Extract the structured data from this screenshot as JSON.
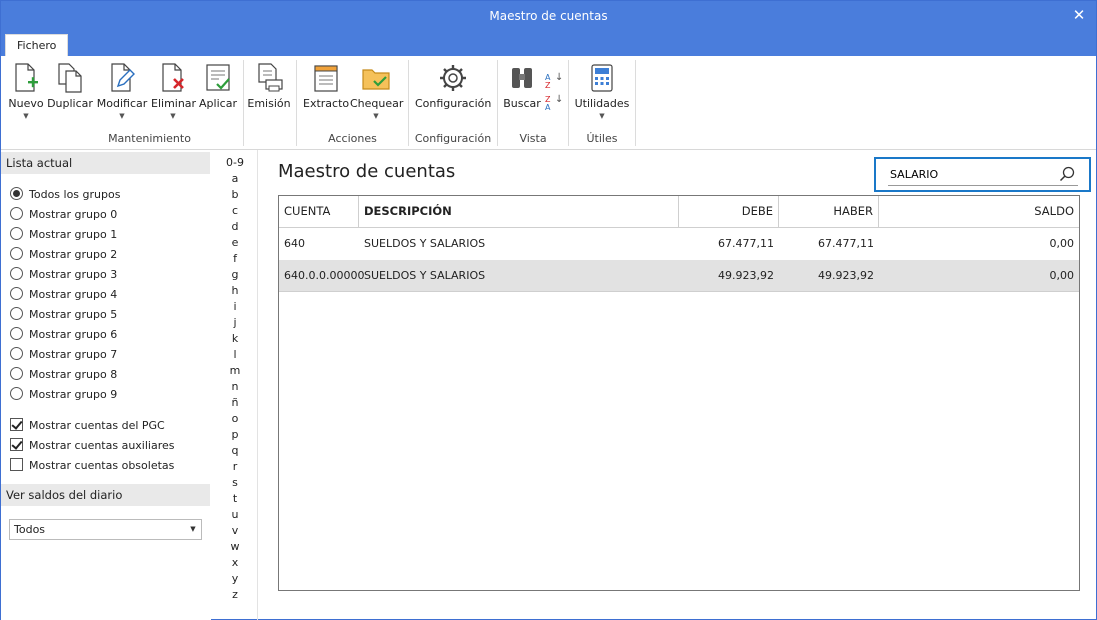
{
  "window": {
    "title": "Maestro de cuentas",
    "close_glyph": "✕"
  },
  "tabs": {
    "fichero": "Fichero"
  },
  "ribbon": {
    "buttons": {
      "nuevo": "Nuevo",
      "duplicar": "Duplicar",
      "modificar": "Modificar",
      "eliminar": "Eliminar",
      "aplicar": "Aplicar",
      "emision": "Emisión",
      "extracto": "Extracto",
      "chequear": "Chequear",
      "configuracion": "Configuración",
      "buscar": "Buscar",
      "utilidades": "Utilidades"
    },
    "groups": {
      "mantenimiento": "Mantenimiento",
      "acciones": "Acciones",
      "configuracion": "Configuración",
      "vista": "Vista",
      "utiles": "Útiles"
    },
    "sort_az": {
      "top": "A",
      "bottom": "Z"
    },
    "sort_za": {
      "top": "Z",
      "bottom": "A"
    }
  },
  "sidebar": {
    "lista_actual": "Lista actual",
    "radios": [
      {
        "label": "Todos los grupos",
        "selected": true
      },
      {
        "label": "Mostrar grupo 0",
        "selected": false
      },
      {
        "label": "Mostrar grupo 1",
        "selected": false
      },
      {
        "label": "Mostrar grupo 2",
        "selected": false
      },
      {
        "label": "Mostrar grupo 3",
        "selected": false
      },
      {
        "label": "Mostrar grupo 4",
        "selected": false
      },
      {
        "label": "Mostrar grupo 5",
        "selected": false
      },
      {
        "label": "Mostrar grupo 6",
        "selected": false
      },
      {
        "label": "Mostrar grupo 7",
        "selected": false
      },
      {
        "label": "Mostrar grupo 8",
        "selected": false
      },
      {
        "label": "Mostrar grupo 9",
        "selected": false
      }
    ],
    "checks": [
      {
        "label": "Mostrar cuentas del PGC",
        "checked": true
      },
      {
        "label": "Mostrar cuentas auxiliares",
        "checked": true
      },
      {
        "label": "Mostrar cuentas obsoletas",
        "checked": false
      }
    ],
    "ver_saldos": "Ver saldos del diario",
    "combo_value": "Todos"
  },
  "alphabet": [
    "0-9",
    "a",
    "b",
    "c",
    "d",
    "e",
    "f",
    "g",
    "h",
    "i",
    "j",
    "k",
    "l",
    "m",
    "n",
    "ñ",
    "o",
    "p",
    "q",
    "r",
    "s",
    "t",
    "u",
    "v",
    "w",
    "x",
    "y",
    "z"
  ],
  "main": {
    "title": "Maestro de cuentas",
    "search_value": "SALARIO",
    "columns": {
      "cuenta": "CUENTA",
      "descripcion": "DESCRIPCIÓN",
      "debe": "DEBE",
      "haber": "HABER",
      "saldo": "SALDO"
    },
    "rows": [
      {
        "cuenta": "640",
        "descripcion": "SUELDOS Y SALARIOS",
        "debe": "67.477,11",
        "haber": "67.477,11",
        "saldo": "0,00",
        "selected": false
      },
      {
        "cuenta": "640.0.0.00000",
        "descripcion": "SUELDOS Y SALARIOS",
        "debe": "49.923,92",
        "haber": "49.923,92",
        "saldo": "0,00",
        "selected": true
      }
    ]
  },
  "colors": {
    "title_bar": "#4a7ddc",
    "search_border": "#1a78c8",
    "selected_row": "#e2e2e2",
    "section_header": "#e9e9e9"
  }
}
